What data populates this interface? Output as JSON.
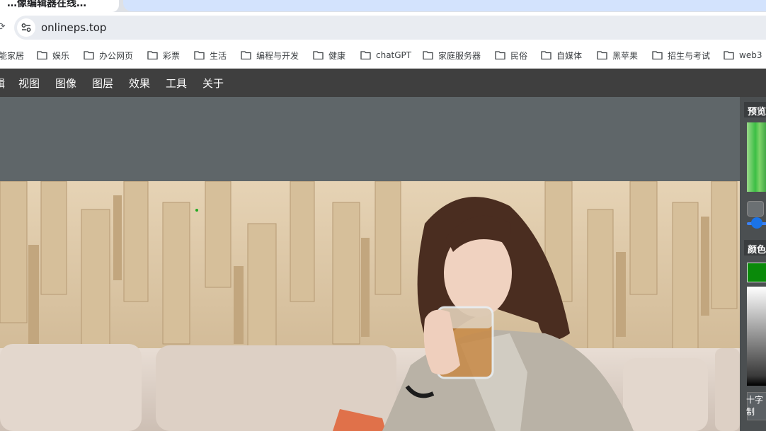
{
  "browser": {
    "tab_title": "…像编辑器在线…",
    "url": "onlineps.top",
    "bookmarks": [
      "能家居",
      "娱乐",
      "办公网页",
      "彩票",
      "生活",
      "编程与开发",
      "健康",
      "chatGPT",
      "家庭服务器",
      "民俗",
      "自媒体",
      "黑苹果",
      "招生与考试",
      "web3"
    ]
  },
  "app": {
    "menu": [
      "辑",
      "视图",
      "图像",
      "图层",
      "效果",
      "工具",
      "关于"
    ],
    "panels": {
      "preview_title": "预览",
      "color_title": "颜色",
      "crosshair_label": "十字制"
    },
    "colors": {
      "menubar": "#3f3f3f",
      "workspace": "#5f6669",
      "current_color": "#0a8a0a"
    }
  }
}
